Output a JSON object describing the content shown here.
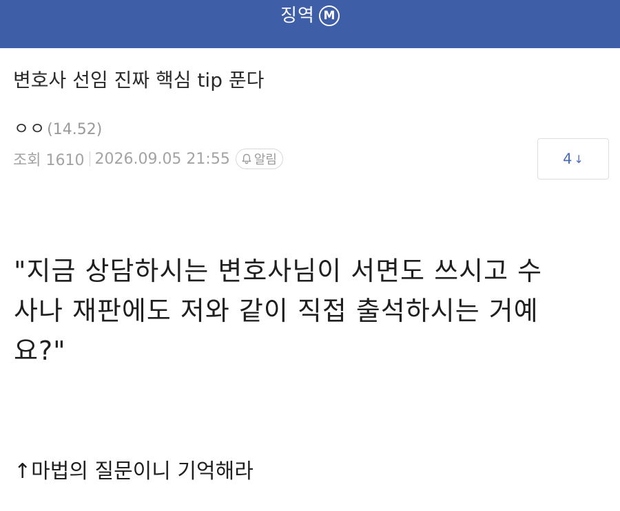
{
  "header": {
    "board_name": "징역",
    "mobile_badge": "M",
    "background_color": "#3f5ea8"
  },
  "post": {
    "title": "변호사 선임 진짜 핵심 tip 푼다",
    "author": {
      "name": "ㅇㅇ",
      "ip": "(14.52)"
    },
    "meta": {
      "views_label": "조회 1610",
      "date": "2026.09.05 21:55",
      "notify_label": "알림",
      "notify_icon": "bell-icon"
    },
    "comment_count": "4",
    "comment_icon": "arrow-down-icon",
    "body_lines": [
      "\"지금 상담하시는 변호사님이 서면도 쓰시고 수",
      "사나 재판에도 저와 같이 직접 출석하시는 거예",
      "요?\""
    ],
    "footer": "↑마법의 질문이니 기억해라"
  }
}
